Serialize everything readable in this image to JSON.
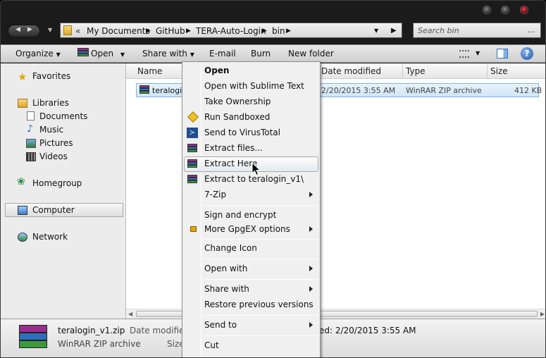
{
  "window": {
    "breadcrumbs": [
      "My Documents",
      "GitHub",
      "TERA-Auto-Login",
      "bin"
    ],
    "search_placeholder": "Search bin"
  },
  "toolbar": {
    "organize": "Organize",
    "open": "Open",
    "share_with": "Share with",
    "email": "E-mail",
    "burn": "Burn",
    "new_folder": "New folder"
  },
  "nav": {
    "favorites": "Favorites",
    "libraries": "Libraries",
    "documents": "Documents",
    "music": "Music",
    "pictures": "Pictures",
    "videos": "Videos",
    "homegroup": "Homegroup",
    "computer": "Computer",
    "network": "Network"
  },
  "columns": {
    "name": "Name",
    "date": "Date modified",
    "type": "Type",
    "size": "Size"
  },
  "file": {
    "name": "teralogin",
    "date": "2/20/2015 3:55 AM",
    "type": "WinRAR ZIP archive",
    "size": "412 KB"
  },
  "details": {
    "filename": "teralogin_v1.zip",
    "filetype": "WinRAR ZIP archive",
    "date_label": "Date modified",
    "size_label": "Size",
    "created_value": "ed: 2/20/2015 3:55 AM"
  },
  "menu": {
    "open": "Open",
    "open_sublime": "Open with Sublime Text",
    "take_ownership": "Take Ownership",
    "run_sandboxed": "Run Sandboxed",
    "send_virustotal": "Send to VirusTotal",
    "extract_files": "Extract files...",
    "extract_here": "Extract Here",
    "extract_to": "Extract to teralogin_v1\\",
    "seven_zip": "7-Zip",
    "sign_encrypt": "Sign and encrypt",
    "gpgex": "More GpgEX options",
    "change_icon": "Change Icon",
    "open_with": "Open with",
    "share_with": "Share with",
    "restore": "Restore previous versions",
    "send_to": "Send to",
    "cut": "Cut"
  },
  "colors": {
    "highlight_border": "#7db4e0",
    "menu_bg": "#f0f0f0",
    "chrome_dark": "#1b1b1b"
  }
}
